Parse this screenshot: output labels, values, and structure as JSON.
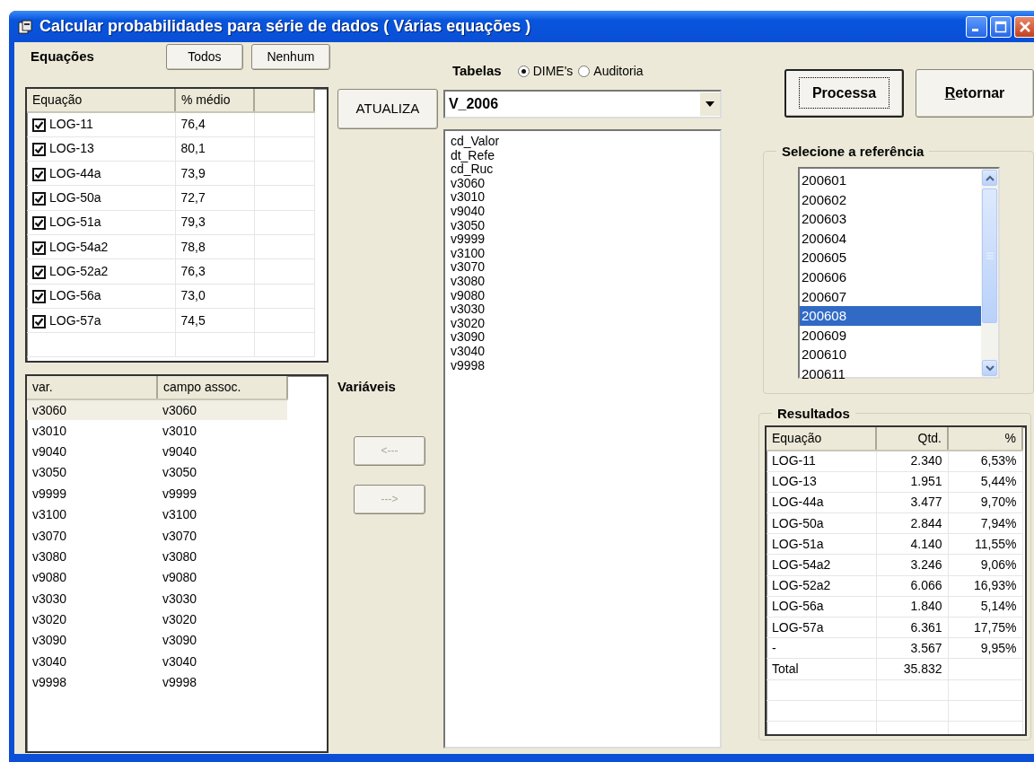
{
  "window": {
    "title": "Calcular probabilidades para série de dados ( Várias equações )"
  },
  "equations": {
    "label": "Equações",
    "buttons": [
      "Todos",
      "Nenhum"
    ],
    "columns": [
      "Equação",
      "% médio"
    ],
    "rows": [
      {
        "name": "LOG-11",
        "checked": true,
        "mean": "76,4"
      },
      {
        "name": "LOG-13",
        "checked": true,
        "mean": "80,1"
      },
      {
        "name": "LOG-44a",
        "checked": true,
        "mean": "73,9"
      },
      {
        "name": "LOG-50a",
        "checked": true,
        "mean": "72,7"
      },
      {
        "name": "LOG-51a",
        "checked": true,
        "mean": "79,3"
      },
      {
        "name": "LOG-54a2",
        "checked": true,
        "mean": "78,8"
      },
      {
        "name": "LOG-52a2",
        "checked": true,
        "mean": "76,3"
      },
      {
        "name": "LOG-56a",
        "checked": true,
        "mean": "73,0"
      },
      {
        "name": "LOG-57a",
        "checked": true,
        "mean": "74,5"
      }
    ]
  },
  "update_button": {
    "label": "ATUALIZA"
  },
  "variables": {
    "label": "Variáveis",
    "columns": [
      "var.",
      "campo assoc."
    ],
    "rows": [
      {
        "var": "v3060",
        "field": "v3060",
        "selected": true
      },
      {
        "var": "v3010",
        "field": "v3010",
        "selected": false
      },
      {
        "var": "v9040",
        "field": "v9040",
        "selected": false
      },
      {
        "var": "v3050",
        "field": "v3050",
        "selected": false
      },
      {
        "var": "v9999",
        "field": "v9999",
        "selected": false
      },
      {
        "var": "v3100",
        "field": "v3100",
        "selected": false
      },
      {
        "var": "v3070",
        "field": "v3070",
        "selected": false
      },
      {
        "var": "v3080",
        "field": "v3080",
        "selected": false
      },
      {
        "var": "v9080",
        "field": "v9080",
        "selected": false
      },
      {
        "var": "v3030",
        "field": "v3030",
        "selected": false
      },
      {
        "var": "v3020",
        "field": "v3020",
        "selected": false
      },
      {
        "var": "v3090",
        "field": "v3090",
        "selected": false
      },
      {
        "var": "v3040",
        "field": "v3040",
        "selected": false
      },
      {
        "var": "v9998",
        "field": "v9998",
        "selected": false
      }
    ],
    "move_buttons": [
      {
        "label": "<---",
        "disabled": true
      },
      {
        "label": "--->",
        "disabled": true
      }
    ]
  },
  "tables": {
    "label": "Tabelas",
    "options": [
      {
        "label": "DIME's",
        "selected": true
      },
      {
        "label": "Auditoria",
        "selected": false
      }
    ],
    "value": "V_2006",
    "fields": [
      "cd_Valor",
      "dt_Refe",
      "cd_Ruc",
      "v3060",
      "v3010",
      "v9040",
      "v3050",
      "v9999",
      "v3100",
      "v3070",
      "v3080",
      "v9080",
      "v3030",
      "v3020",
      "v3090",
      "v3040",
      "v9998"
    ]
  },
  "actions": [
    {
      "label": "Processa",
      "focused": true,
      "mnemonic": false
    },
    {
      "label": "Retornar",
      "focused": false,
      "mnemonic": true
    }
  ],
  "reference": {
    "label": "Selecione a referência",
    "items": [
      {
        "label": "200601",
        "selected": false
      },
      {
        "label": "200602",
        "selected": false
      },
      {
        "label": "200603",
        "selected": false
      },
      {
        "label": "200604",
        "selected": false
      },
      {
        "label": "200605",
        "selected": false
      },
      {
        "label": "200606",
        "selected": false
      },
      {
        "label": "200607",
        "selected": false
      },
      {
        "label": "200608",
        "selected": true
      },
      {
        "label": "200609",
        "selected": false
      },
      {
        "label": "200610",
        "selected": false
      },
      {
        "label": "200611",
        "selected": false
      }
    ]
  },
  "results": {
    "label": "Resultados",
    "columns": [
      "Equação",
      "Qtd.",
      "%"
    ],
    "rows": [
      [
        "LOG-11",
        "2.340",
        "6,53%"
      ],
      [
        "LOG-13",
        "1.951",
        "5,44%"
      ],
      [
        "LOG-44a",
        "3.477",
        "9,70%"
      ],
      [
        "LOG-50a",
        "2.844",
        "7,94%"
      ],
      [
        "LOG-51a",
        "4.140",
        "11,55%"
      ],
      [
        "LOG-54a2",
        "3.246",
        "9,06%"
      ],
      [
        "LOG-52a2",
        "6.066",
        "16,93%"
      ],
      [
        "LOG-56a",
        "1.840",
        "5,14%"
      ],
      [
        "LOG-57a",
        "6.361",
        "17,75%"
      ],
      [
        "-",
        "3.567",
        "9,95%"
      ],
      [
        "Total",
        "35.832",
        ""
      ]
    ]
  }
}
